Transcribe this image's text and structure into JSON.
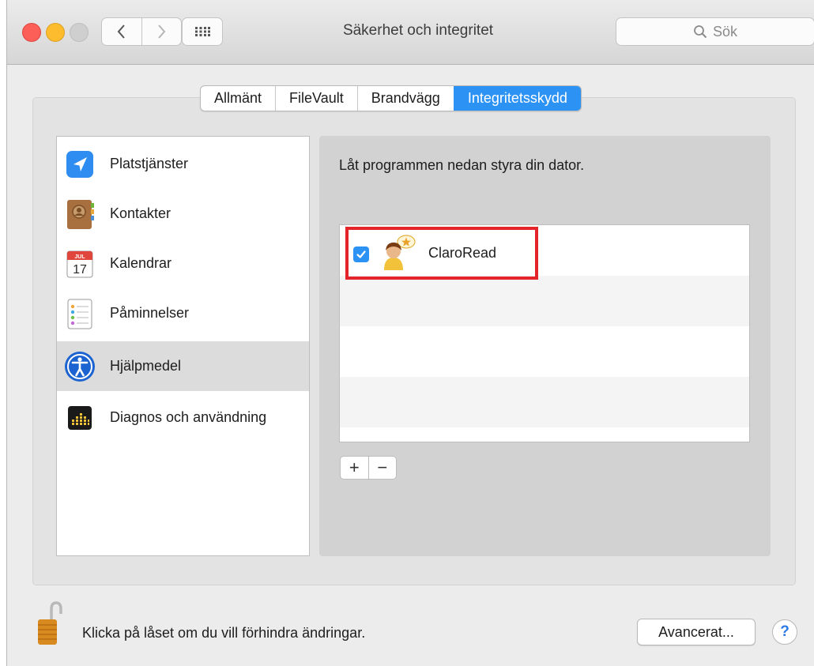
{
  "window": {
    "title": "Säkerhet och integritet"
  },
  "search": {
    "placeholder": "Sök",
    "icon": "magnifier-icon"
  },
  "tabs": [
    {
      "label": "Allmänt",
      "active": false
    },
    {
      "label": "FileVault",
      "active": false
    },
    {
      "label": "Brandvägg",
      "active": false
    },
    {
      "label": "Integritetsskydd",
      "active": true
    }
  ],
  "sidebar": {
    "items": [
      {
        "label": "Platstjänster",
        "icon": "location-arrow-icon",
        "selected": false
      },
      {
        "label": "Kontakter",
        "icon": "contacts-book-icon",
        "selected": false
      },
      {
        "label": "Kalendrar",
        "icon": "calendar-icon",
        "icon_month": "JUL",
        "icon_day": "17",
        "selected": false
      },
      {
        "label": "Påminnelser",
        "icon": "reminders-icon",
        "selected": false
      },
      {
        "label": "Hjälpmedel",
        "icon": "accessibility-icon",
        "selected": true
      },
      {
        "label": "Diagnos och användning",
        "icon": "diagnostics-icon",
        "selected": false
      }
    ]
  },
  "main": {
    "prompt": "Låt programmen nedan styra din dator.",
    "apps": [
      {
        "name": "ClaroRead",
        "checked": true,
        "icon": "claroread-icon"
      }
    ],
    "add_label": "+",
    "remove_label": "−"
  },
  "footer": {
    "lock_text": "Klicka på låset om du vill förhindra ändringar.",
    "advanced_label": "Avancerat...",
    "help_label": "?"
  },
  "colors": {
    "accent": "#2c92f4",
    "highlight": "#e3242b"
  }
}
